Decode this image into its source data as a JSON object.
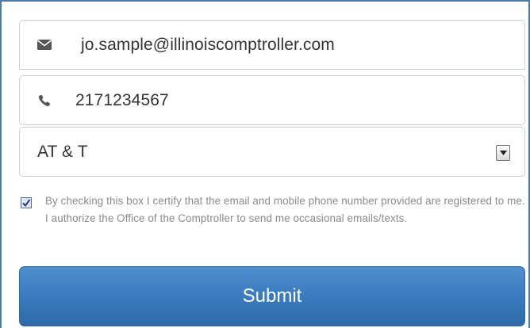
{
  "form": {
    "email": {
      "value": "jo.sample@illinoiscomptroller.com",
      "icon": "envelope-icon"
    },
    "phone": {
      "value": "2171234567",
      "icon": "phone-icon"
    },
    "carrier": {
      "selected": "AT & T",
      "icon": "chevron-down-icon"
    },
    "consent": {
      "checked": true,
      "text": "By checking this box I certify that the email and mobile phone number provided are registered to me. I authorize the Office of the Comptroller to send me occasional emails/texts."
    },
    "submit_label": "Submit"
  },
  "colors": {
    "accent": "#3a7bbf",
    "border": "#cfcfcf",
    "muted_text": "#8a8a8a"
  }
}
